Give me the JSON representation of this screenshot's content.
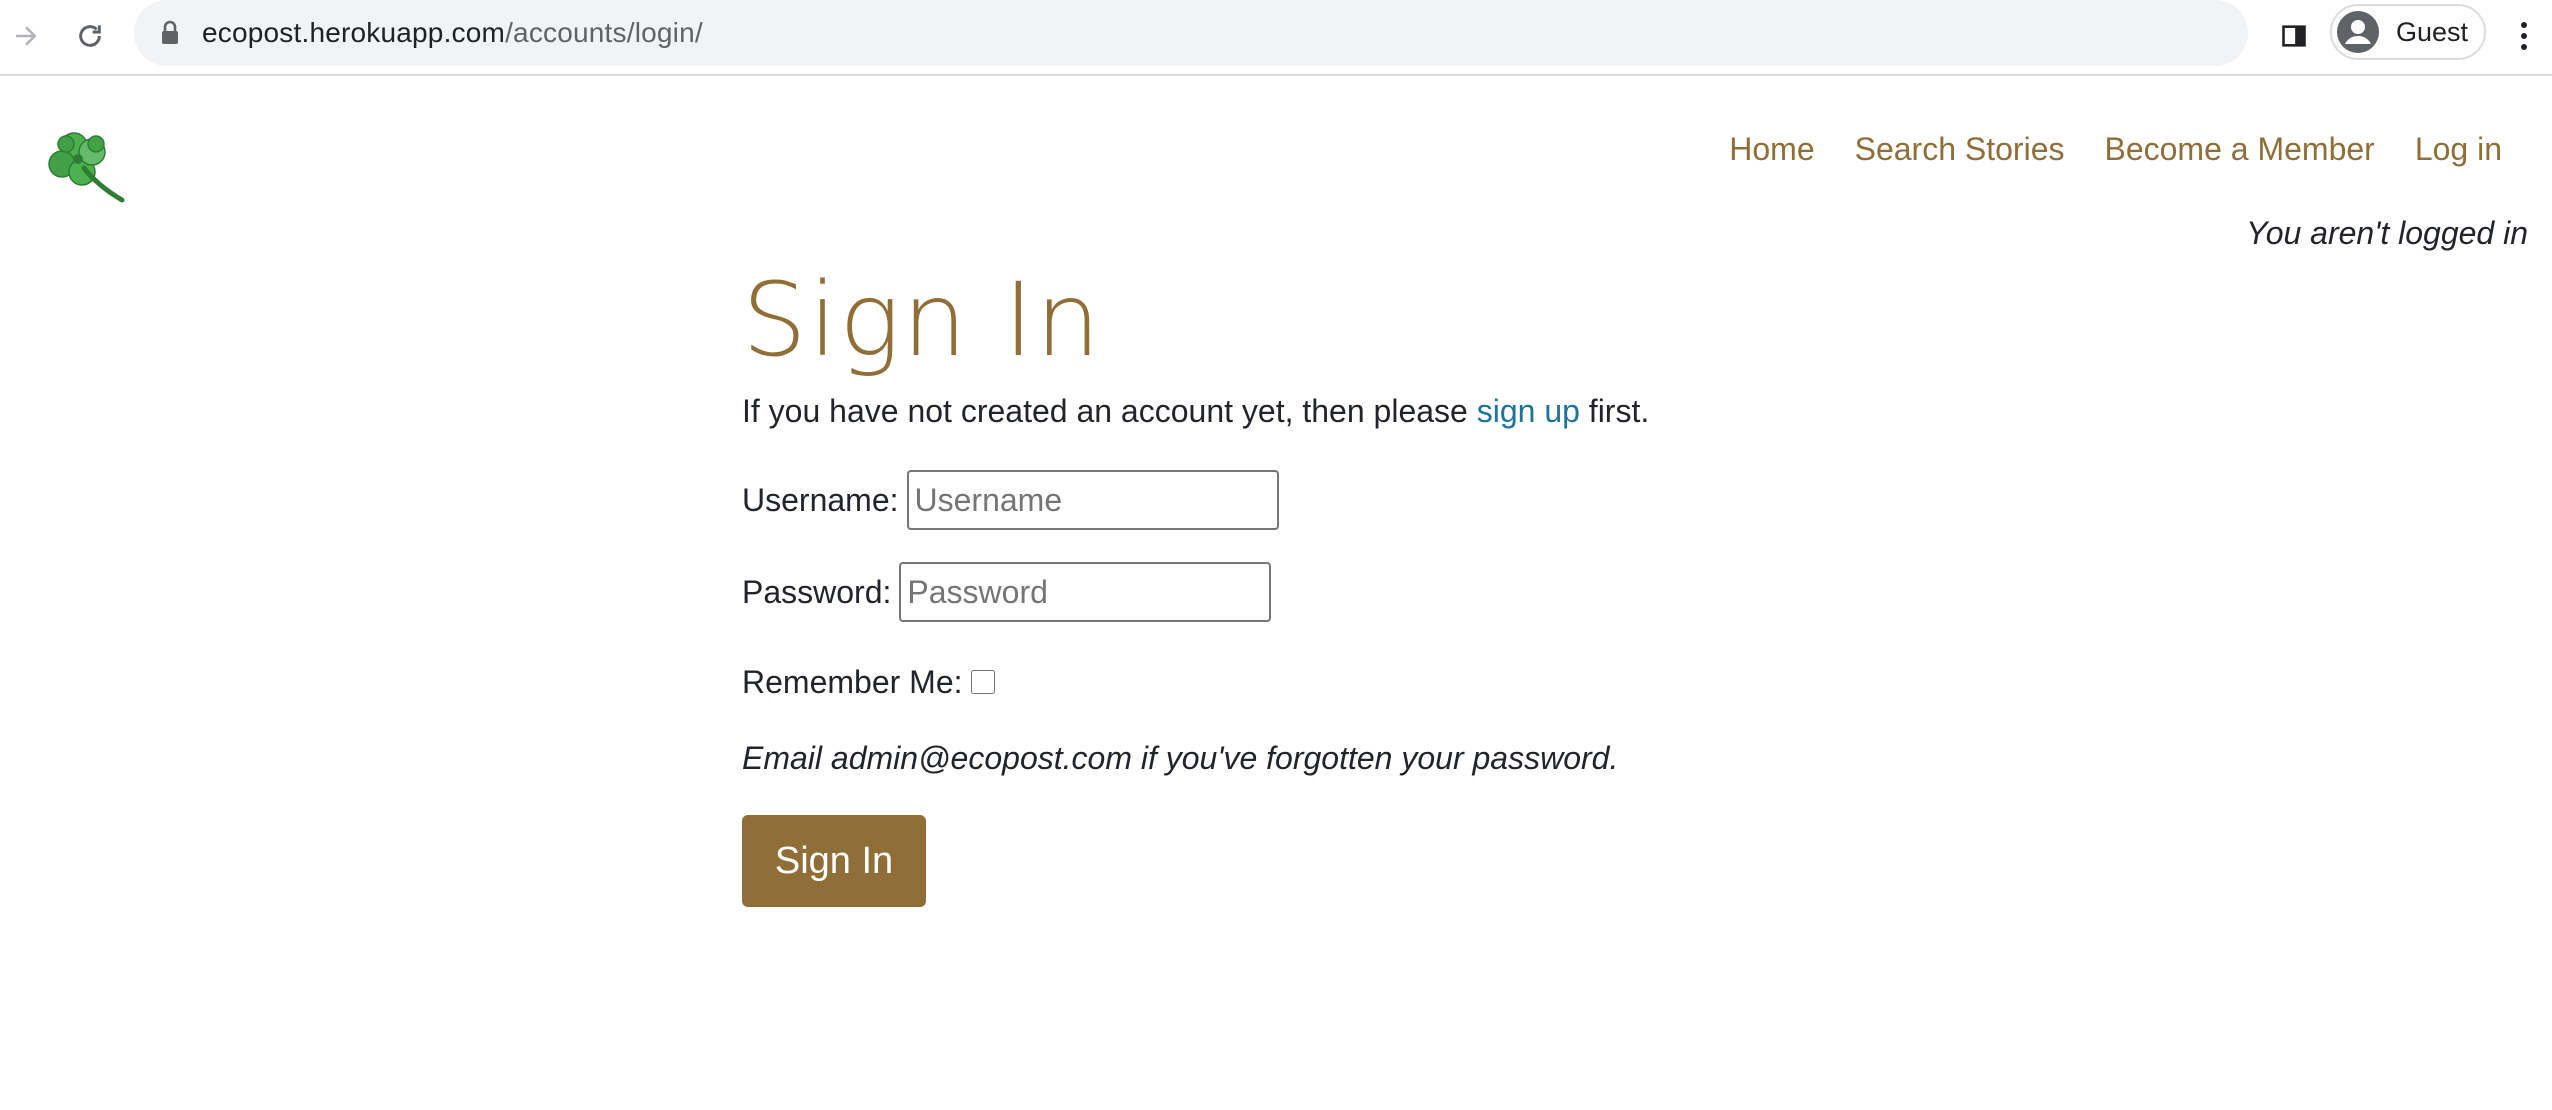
{
  "browser": {
    "url_host": "ecopost.herokuapp.com",
    "url_path": "/accounts/login/",
    "profile_name": "Guest",
    "icons": [
      "forward-arrow-icon",
      "reload-icon",
      "lock-icon",
      "side-panel-icon",
      "account-circle-icon",
      "kebab-menu-icon"
    ]
  },
  "site": {
    "logo_icon": "four-leaf-clover-icon",
    "nav": [
      {
        "label": "Home"
      },
      {
        "label": "Search Stories"
      },
      {
        "label": "Become a Member"
      },
      {
        "label": "Log in"
      }
    ],
    "login_status": "You aren't logged in"
  },
  "page": {
    "title": "Sign In",
    "intro_prefix": "If you have not created an account yet, then please",
    "intro_link": "sign up",
    "intro_suffix": "first.",
    "username_label": "Username:",
    "username_placeholder": "Username",
    "password_label": "Password:",
    "password_placeholder": "Password",
    "remember_label": "Remember Me:",
    "remember_checked": false,
    "forgot_note": "Email admin@ecopost.com if you've forgotten your password.",
    "submit_label": "Sign In"
  },
  "colors": {
    "accent": "#8f6e37",
    "link": "#1f7399",
    "omnibox_bg": "#f1f3f4"
  }
}
